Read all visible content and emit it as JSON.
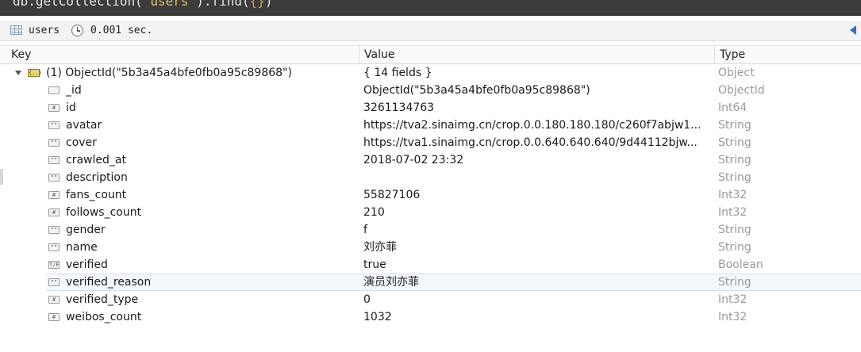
{
  "query": {
    "prefix": "db.getCollection(",
    "collection_literal": "'users'",
    "suffix": ").find(",
    "arg": "{}",
    "end": ")"
  },
  "info": {
    "collection": "users",
    "time": "0.001 sec."
  },
  "columns": {
    "key": "Key",
    "value": "Value",
    "type": "Type"
  },
  "root": {
    "icon": "object-icon",
    "key": "(1) ObjectId(\"5b3a45a4bfe0fb0a95c89868\")",
    "value": "{ 14 fields }",
    "type": "Object"
  },
  "fields": [
    {
      "key": "_id",
      "value": "ObjectId(\"5b3a45a4bfe0fb0a95c89868\")",
      "type": "ObjectId",
      "icon": ""
    },
    {
      "key": "id",
      "value": "3261134763",
      "type": "Int64",
      "icon": "#"
    },
    {
      "key": "avatar",
      "value": "https://tva2.sinaimg.cn/crop.0.0.180.180.180/c260f7abjw1...",
      "type": "String",
      "icon": "\"\""
    },
    {
      "key": "cover",
      "value": "https://tva1.sinaimg.cn/crop.0.0.640.640.640/9d44112bjw...",
      "type": "String",
      "icon": "\"\""
    },
    {
      "key": "crawled_at",
      "value": "2018-07-02 23:32",
      "type": "String",
      "icon": "\"\""
    },
    {
      "key": "description",
      "value": "",
      "type": "String",
      "icon": "\"\""
    },
    {
      "key": "fans_count",
      "value": "55827106",
      "type": "Int32",
      "icon": "#"
    },
    {
      "key": "follows_count",
      "value": "210",
      "type": "Int32",
      "icon": "#"
    },
    {
      "key": "gender",
      "value": "f",
      "type": "String",
      "icon": "\"\""
    },
    {
      "key": "name",
      "value": "刘亦菲",
      "type": "String",
      "icon": "\"\""
    },
    {
      "key": "verified",
      "value": "true",
      "type": "Boolean",
      "icon": "T/F"
    },
    {
      "key": "verified_reason",
      "value": "演员刘亦菲",
      "type": "String",
      "icon": "\"\"",
      "selected": true
    },
    {
      "key": "verified_type",
      "value": "0",
      "type": "Int32",
      "icon": "#"
    },
    {
      "key": "weibos_count",
      "value": "1032",
      "type": "Int32",
      "icon": "#"
    }
  ],
  "colors": {
    "query_bg": "#3c3c3c",
    "type_text": "#9a9a9a",
    "selected_row": "#f4f8fd"
  }
}
